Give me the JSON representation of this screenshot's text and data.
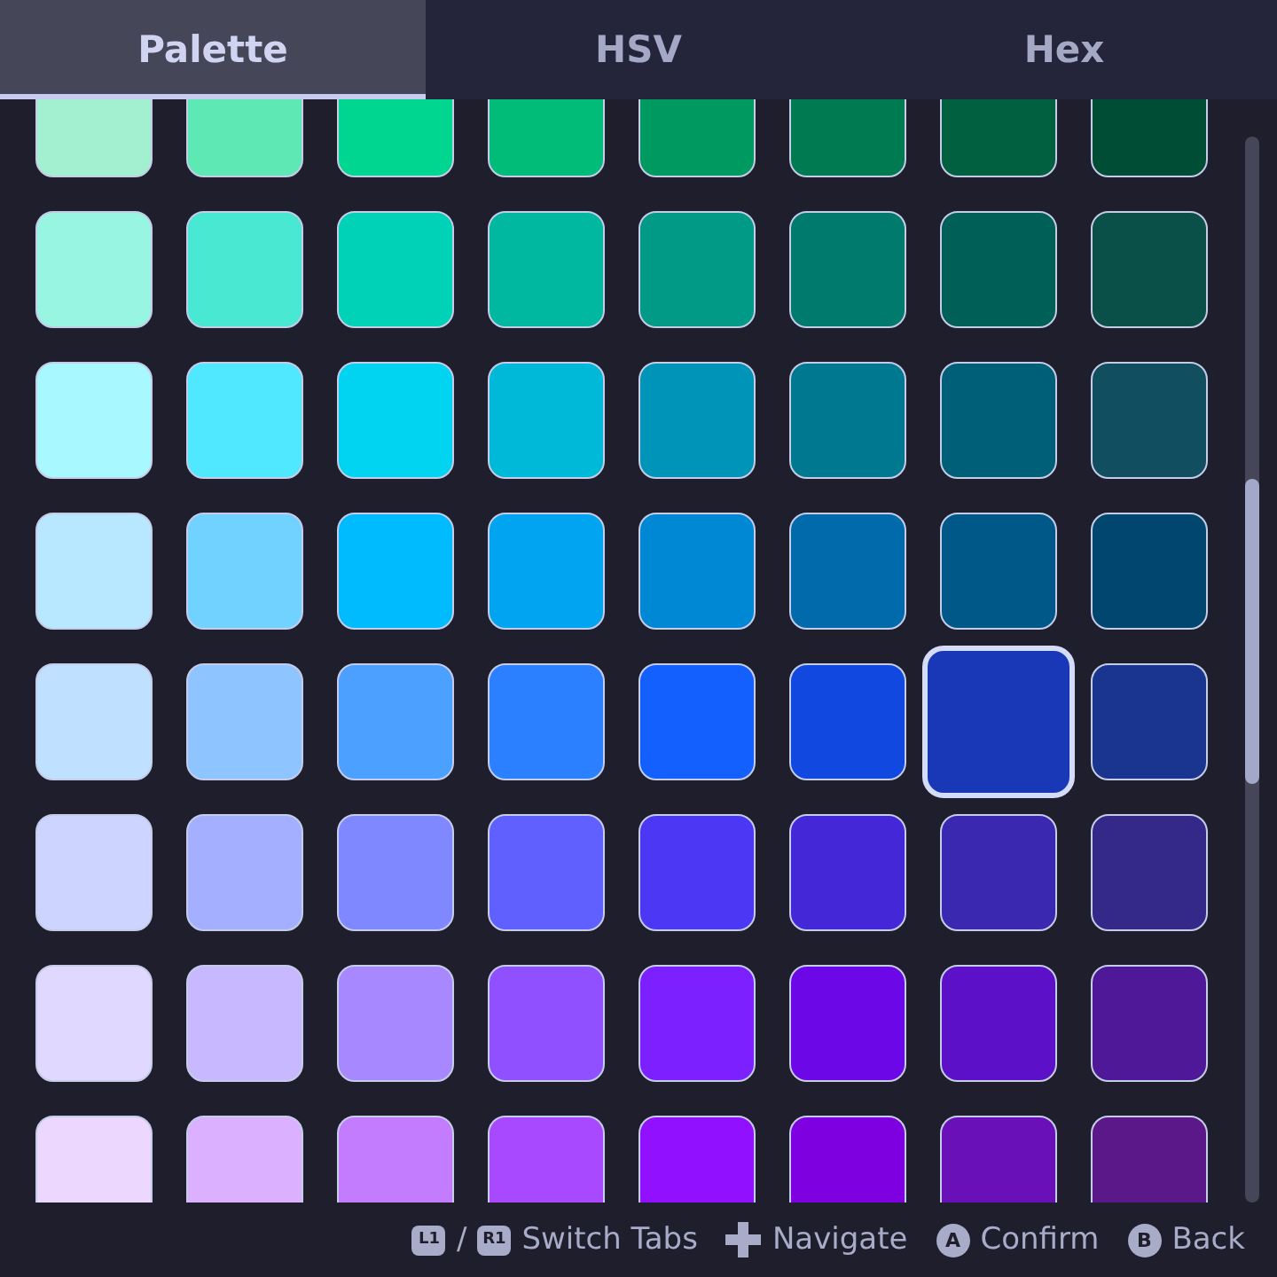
{
  "tabs": [
    {
      "label": "Palette",
      "selected": true
    },
    {
      "label": "HSV",
      "selected": false
    },
    {
      "label": "Hex",
      "selected": false
    }
  ],
  "palette": {
    "rows": [
      {
        "swatches": [
          {
            "color": "#a3f0d0",
            "selected": false
          },
          {
            "color": "#5ee8b4",
            "selected": false
          },
          {
            "color": "#00d690",
            "selected": false
          },
          {
            "color": "#00bc78",
            "selected": false
          },
          {
            "color": "#009a60",
            "selected": false
          },
          {
            "color": "#007a50",
            "selected": false
          },
          {
            "color": "#006040",
            "selected": false
          },
          {
            "color": "#004d36",
            "selected": false
          }
        ]
      },
      {
        "swatches": [
          {
            "color": "#98f5e1",
            "selected": false
          },
          {
            "color": "#48e8d2",
            "selected": false
          },
          {
            "color": "#00d2b8",
            "selected": false
          },
          {
            "color": "#00b8a0",
            "selected": false
          },
          {
            "color": "#009a86",
            "selected": false
          },
          {
            "color": "#007a6c",
            "selected": false
          },
          {
            "color": "#006058",
            "selected": false
          },
          {
            "color": "#0a5048",
            "selected": false
          }
        ]
      },
      {
        "swatches": [
          {
            "color": "#a8f8ff",
            "selected": false
          },
          {
            "color": "#50e8ff",
            "selected": false
          },
          {
            "color": "#00d4f0",
            "selected": false
          },
          {
            "color": "#00b8d8",
            "selected": false
          },
          {
            "color": "#0094b8",
            "selected": false
          },
          {
            "color": "#007890",
            "selected": false
          },
          {
            "color": "#005f78",
            "selected": false
          },
          {
            "color": "#104e60",
            "selected": false
          }
        ]
      },
      {
        "swatches": [
          {
            "color": "#b8e8ff",
            "selected": false
          },
          {
            "color": "#72d2ff",
            "selected": false
          },
          {
            "color": "#00bcff",
            "selected": false
          },
          {
            "color": "#00a4f0",
            "selected": false
          },
          {
            "color": "#0088d4",
            "selected": false
          },
          {
            "color": "#006aaa",
            "selected": false
          },
          {
            "color": "#005888",
            "selected": false
          },
          {
            "color": "#00466e",
            "selected": false
          }
        ]
      },
      {
        "swatches": [
          {
            "color": "#c0e0ff",
            "selected": false
          },
          {
            "color": "#8ec4ff",
            "selected": false
          },
          {
            "color": "#4ca0ff",
            "selected": false
          },
          {
            "color": "#2a80ff",
            "selected": false
          },
          {
            "color": "#1460ff",
            "selected": false
          },
          {
            "color": "#1048e0",
            "selected": false
          },
          {
            "color": "#1838b8",
            "selected": true
          },
          {
            "color": "#1a3590",
            "selected": false
          }
        ]
      },
      {
        "swatches": [
          {
            "color": "#cdd4ff",
            "selected": false
          },
          {
            "color": "#a4b0ff",
            "selected": false
          },
          {
            "color": "#8088ff",
            "selected": false
          },
          {
            "color": "#6060ff",
            "selected": false
          },
          {
            "color": "#4c38f4",
            "selected": false
          },
          {
            "color": "#4428d8",
            "selected": false
          },
          {
            "color": "#3a28b0",
            "selected": false
          },
          {
            "color": "#342888",
            "selected": false
          }
        ]
      },
      {
        "swatches": [
          {
            "color": "#e0d8ff",
            "selected": false
          },
          {
            "color": "#c8b8ff",
            "selected": false
          },
          {
            "color": "#a888ff",
            "selected": false
          },
          {
            "color": "#9050ff",
            "selected": false
          },
          {
            "color": "#7c20ff",
            "selected": false
          },
          {
            "color": "#6c08e8",
            "selected": false
          },
          {
            "color": "#5c10c8",
            "selected": false
          },
          {
            "color": "#4e1898",
            "selected": false
          }
        ]
      },
      {
        "swatches": [
          {
            "color": "#ecd8ff",
            "selected": false
          },
          {
            "color": "#dab0ff",
            "selected": false
          },
          {
            "color": "#c47cff",
            "selected": false
          },
          {
            "color": "#a848ff",
            "selected": false
          },
          {
            "color": "#9010ff",
            "selected": false
          },
          {
            "color": "#7e00e0",
            "selected": false
          },
          {
            "color": "#6a10b8",
            "selected": false
          },
          {
            "color": "#5a1888",
            "selected": false
          }
        ]
      }
    ]
  },
  "footer": {
    "hints": [
      {
        "keys": [
          {
            "kind": "shoulder",
            "label": "L1"
          },
          {
            "kind": "shoulder",
            "label": "R1"
          }
        ],
        "separator": "/",
        "action": "Switch Tabs"
      },
      {
        "keys": [
          {
            "kind": "dpad"
          }
        ],
        "action": "Navigate"
      },
      {
        "keys": [
          {
            "kind": "face",
            "label": "A"
          }
        ],
        "action": "Confirm"
      },
      {
        "keys": [
          {
            "kind": "face",
            "label": "B"
          }
        ],
        "action": "Back"
      }
    ]
  }
}
